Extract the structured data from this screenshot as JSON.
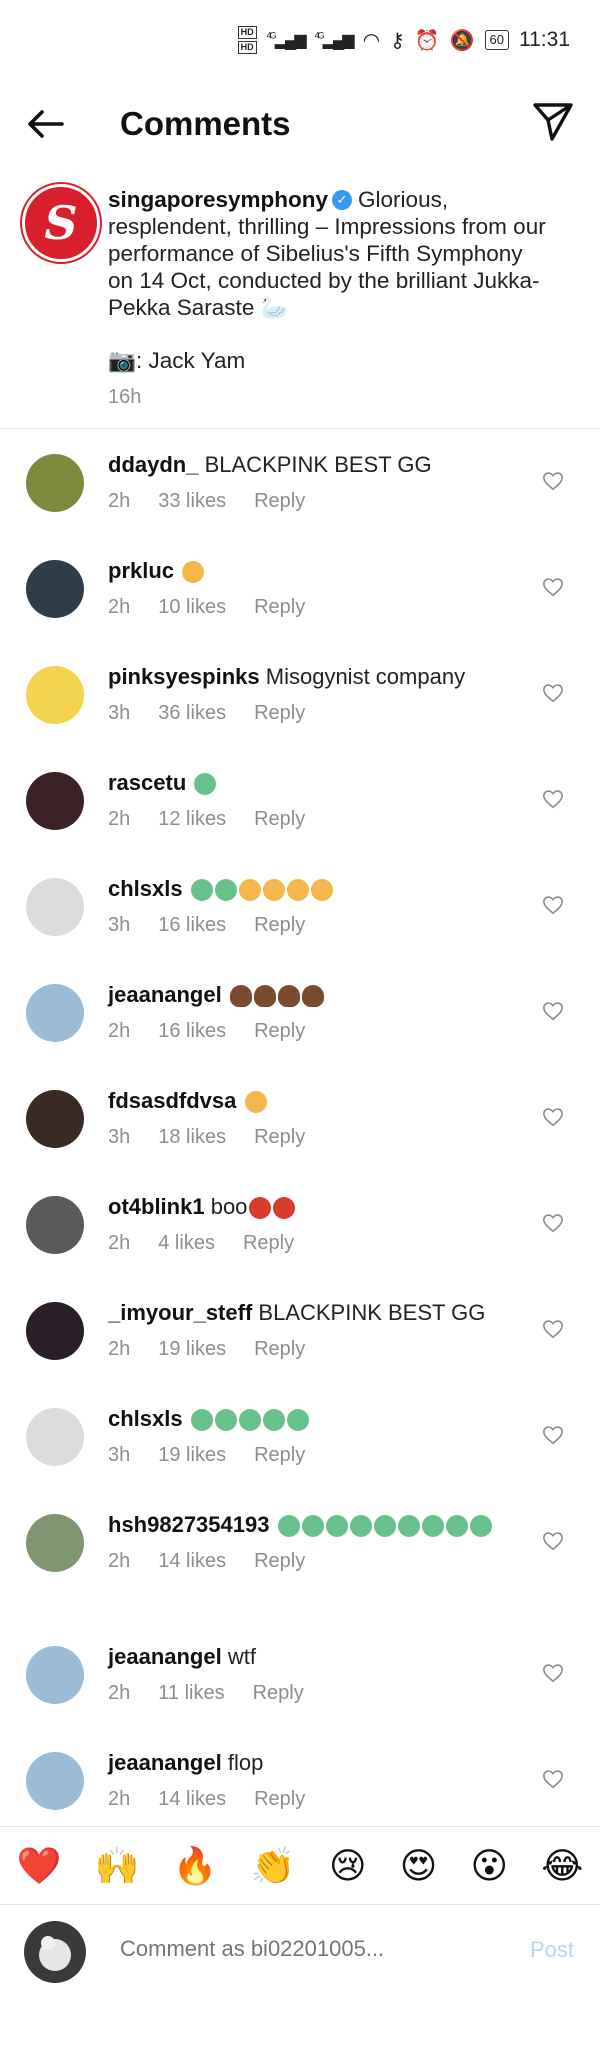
{
  "status_bar": {
    "hd_top": "HD",
    "hd_bottom": "HD",
    "signal1": "4G",
    "signal2": "4G",
    "battery": "60",
    "time": "11:31"
  },
  "header": {
    "title": "Comments",
    "back_icon": "arrow-left-icon",
    "send_icon": "paper-plane-icon"
  },
  "caption": {
    "username": "singaporesymphony",
    "text": "Glorious, resplendent, thrilling – Impressions from our performance of Sibelius's Fifth Symphony on 14 Oct, conducted by the brilliant Jukka-Pekka Saraste 🦢",
    "credit": "📷: Jack Yam",
    "time": "16h",
    "logo_letter": "S"
  },
  "comments": [
    {
      "user": "ddaydn_",
      "text": "BLACKPINK BEST GG",
      "emojis": [],
      "time": "2h",
      "likes": "33 likes",
      "reply": "Reply",
      "avatar": "#7d8a3d"
    },
    {
      "user": "prkluc",
      "text": "",
      "emojis": [
        "vomit"
      ],
      "time": "2h",
      "likes": "10 likes",
      "reply": "Reply",
      "avatar": "#2f3c4a"
    },
    {
      "user": "pinksyespinks",
      "text": "Misogynist company",
      "emojis": [],
      "time": "3h",
      "likes": "36 likes",
      "reply": "Reply",
      "avatar": "#f4d44f"
    },
    {
      "user": "rascetu",
      "text": "",
      "emojis": [
        "sick"
      ],
      "time": "2h",
      "likes": "12 likes",
      "reply": "Reply",
      "avatar": "#3b2226"
    },
    {
      "user": "chlsxls",
      "text": "",
      "emojis": [
        "sick",
        "sick",
        "vomit",
        "vomit",
        "vomit",
        "vomit"
      ],
      "time": "3h",
      "likes": "16 likes",
      "reply": "Reply",
      "avatar": "#dcdcdc"
    },
    {
      "user": "jeaanangel",
      "text": "",
      "emojis": [
        "poop",
        "poop",
        "poop",
        "poop"
      ],
      "time": "2h",
      "likes": "16 likes",
      "reply": "Reply",
      "avatar": "#9bbcd6"
    },
    {
      "user": "fdsasdfdvsa",
      "text": "",
      "emojis": [
        "vomit"
      ],
      "time": "3h",
      "likes": "18 likes",
      "reply": "Reply",
      "avatar": "#3a2a24"
    },
    {
      "user": "ot4blink1",
      "text": "boo",
      "emojis": [
        "tomato",
        "tomato"
      ],
      "time": "2h",
      "likes": "4 likes",
      "reply": "Reply",
      "avatar": "#5a5a5a"
    },
    {
      "user": "_imyour_steff",
      "text": "BLACKPINK BEST GG",
      "emojis": [],
      "time": "2h",
      "likes": "19 likes",
      "reply": "Reply",
      "avatar": "#2a1f28"
    },
    {
      "user": "chlsxls",
      "text": "",
      "emojis": [
        "sick",
        "sick",
        "sick",
        "sick",
        "sick"
      ],
      "time": "3h",
      "likes": "19 likes",
      "reply": "Reply",
      "avatar": "#dcdcdc"
    },
    {
      "user": "hsh9827354193",
      "text": "",
      "emojis": [
        "sick",
        "sick",
        "sick",
        "sick",
        "sick",
        "sick",
        "sick",
        "sick",
        "sick"
      ],
      "time": "2h",
      "likes": "14 likes",
      "reply": "Reply",
      "avatar": "#7f9670"
    },
    {
      "user": "jeaanangel",
      "text": "wtf",
      "emojis": [],
      "time": "2h",
      "likes": "11 likes",
      "reply": "Reply",
      "avatar": "#9bbcd6"
    },
    {
      "user": "jeaanangel",
      "text": "flop",
      "emojis": [],
      "time": "2h",
      "likes": "14 likes",
      "reply": "Reply",
      "avatar": "#9bbcd6"
    }
  ],
  "reactions": [
    "❤️",
    "🙌",
    "🔥",
    "👏",
    "😢",
    "😍",
    "😮",
    "😂"
  ],
  "compose": {
    "placeholder": "Comment as bi02201005...",
    "post": "Post"
  }
}
